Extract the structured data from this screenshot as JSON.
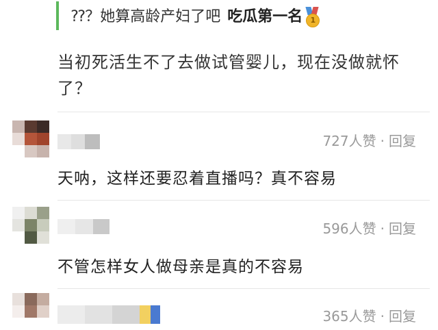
{
  "quote": {
    "prefix": "⁇？她算高龄产妇了吧",
    "highlight": "吃瓜第一名",
    "medal_icon": "gold-medal-icon",
    "accent_color": "#5cb85c"
  },
  "post": {
    "text": "当初死活生不了去做试管婴儿，现在没做就怀了？"
  },
  "comments": [
    {
      "likes": "727人赞",
      "separator": "·",
      "reply_label": "回复",
      "text": "天呐，这样还要忍着直播吗？真不容易"
    },
    {
      "likes": "596人赞",
      "separator": "·",
      "reply_label": "回复",
      "text": "不管怎样女人做母亲是真的不容易"
    },
    {
      "likes": "365人赞",
      "separator": "·",
      "reply_label": "回复",
      "text": ""
    }
  ]
}
